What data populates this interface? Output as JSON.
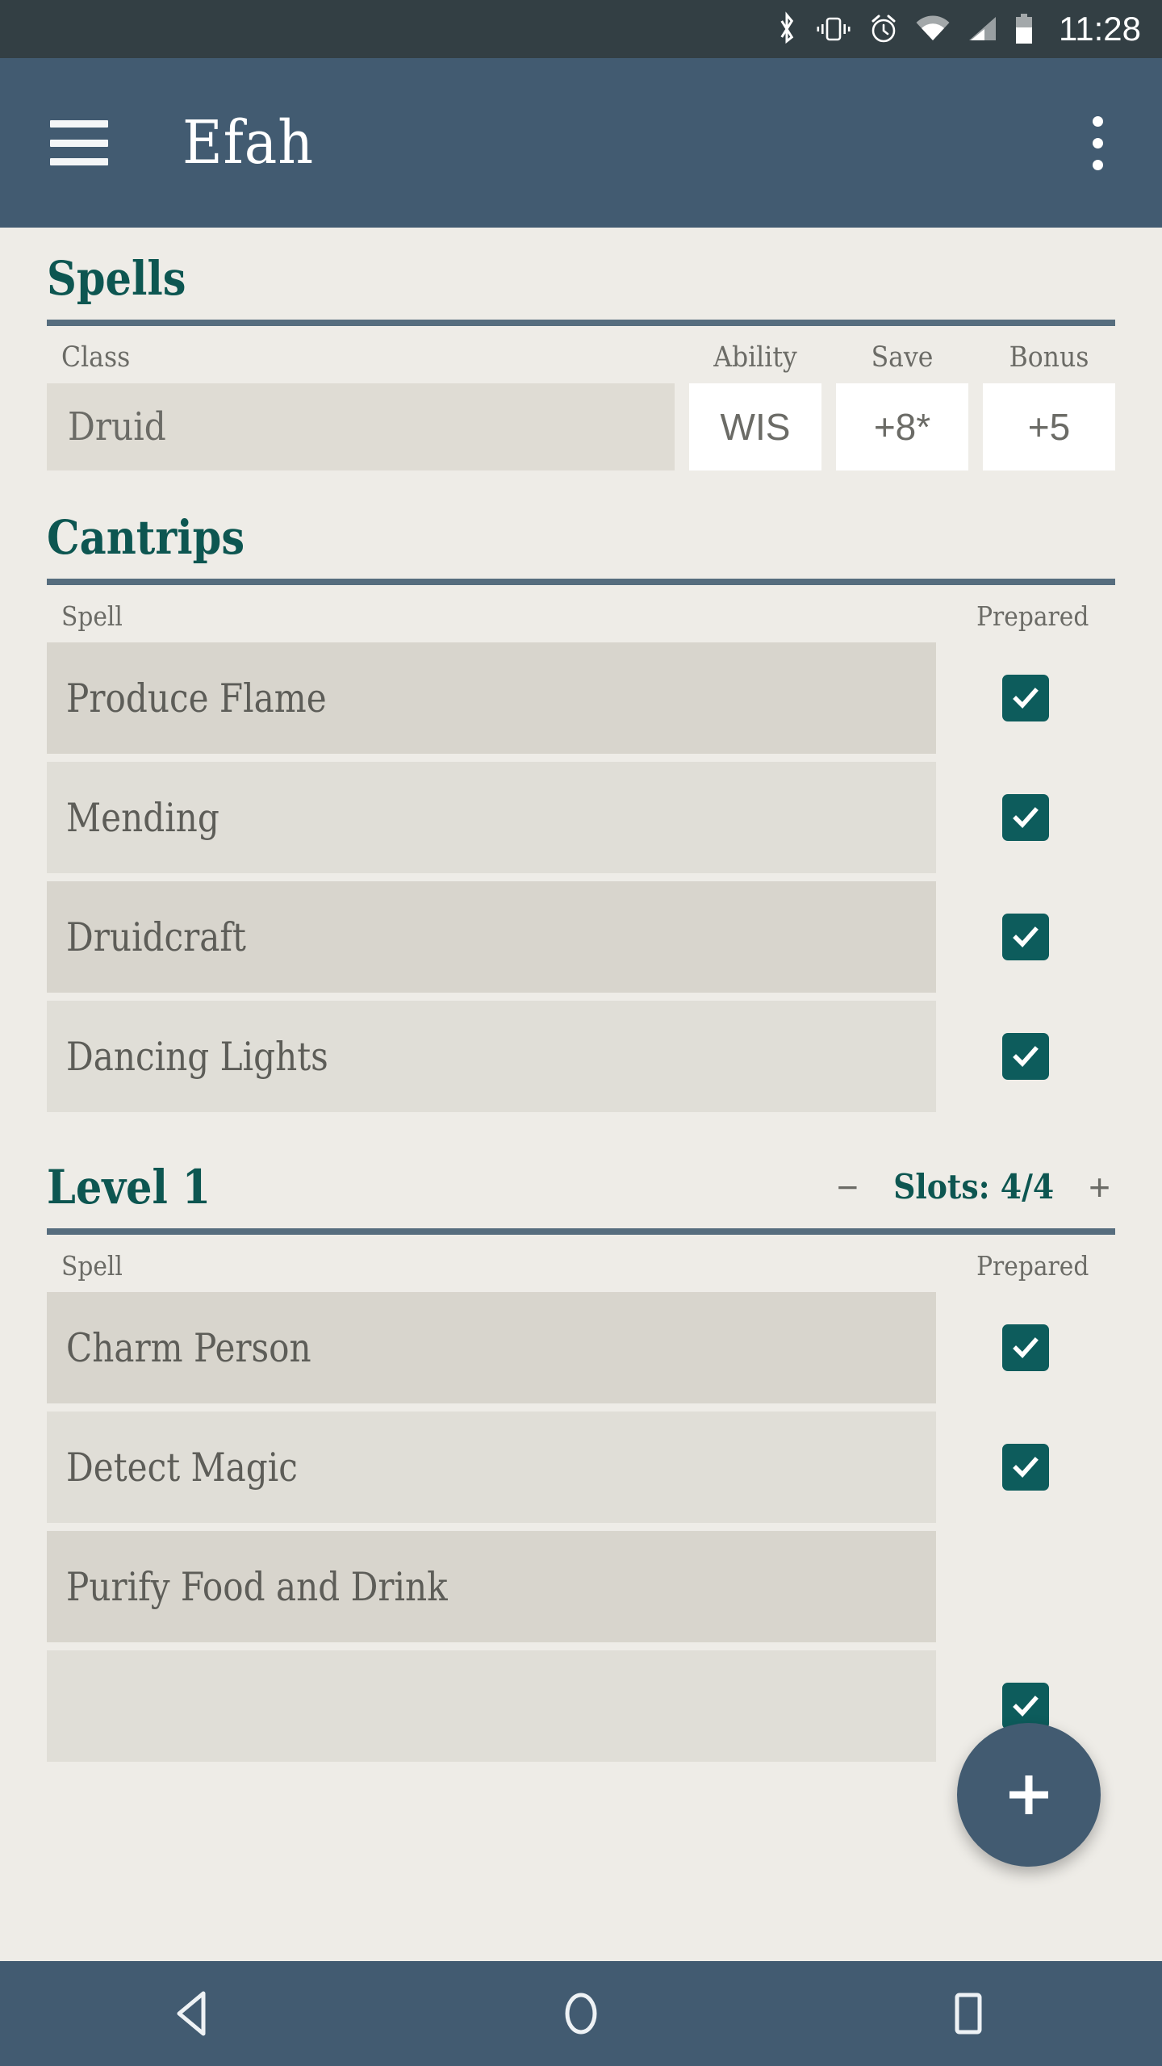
{
  "status_bar": {
    "icons": [
      "bluetooth-icon",
      "vibrate-icon",
      "alarm-icon",
      "wifi-icon",
      "cellular-signal-icon",
      "battery-icon"
    ],
    "time": "11:28"
  },
  "app_bar": {
    "menu_icon": "hamburger-menu-icon",
    "title": "Efah",
    "overflow_icon": "overflow-menu-icon"
  },
  "spells_section": {
    "heading": "Spells",
    "headers": {
      "class": "Class",
      "ability": "Ability",
      "save": "Save",
      "bonus": "Bonus"
    },
    "row": {
      "class": "Druid",
      "ability": "WIS",
      "save": "+8*",
      "bonus": "+5"
    }
  },
  "cantrips_section": {
    "heading": "Cantrips",
    "headers": {
      "spell": "Spell",
      "prepared": "Prepared"
    },
    "rows": [
      {
        "name": "Produce Flame",
        "prepared": true
      },
      {
        "name": "Mending",
        "prepared": true
      },
      {
        "name": "Druidcraft",
        "prepared": true
      },
      {
        "name": "Dancing Lights",
        "prepared": true
      }
    ]
  },
  "level1_section": {
    "heading": "Level 1",
    "decrement_label": "−",
    "slots_label": "Slots: 4/4",
    "increment_label": "+",
    "headers": {
      "spell": "Spell",
      "prepared": "Prepared"
    },
    "rows": [
      {
        "name": "Charm Person",
        "prepared": true
      },
      {
        "name": "Detect Magic",
        "prepared": true
      },
      {
        "name": "Purify Food and Drink",
        "prepared": true
      },
      {
        "name": "",
        "prepared": true
      }
    ]
  },
  "fab": {
    "icon": "plus-icon",
    "label": "+"
  },
  "nav_bar": {
    "back": "back-triangle-icon",
    "home": "home-circle-icon",
    "recents": "recents-square-icon"
  },
  "colors": {
    "page_background": "#eeece7",
    "app_bar": "#425b71",
    "status_bar": "#333f44",
    "accent_teal": "#0d5651",
    "checkbox_teal": "#0d5c5c",
    "rule": "#566d7e",
    "row_dark": "#d8d5cd",
    "row_light": "#e0ded7",
    "text_grey": "#6b6b66"
  }
}
